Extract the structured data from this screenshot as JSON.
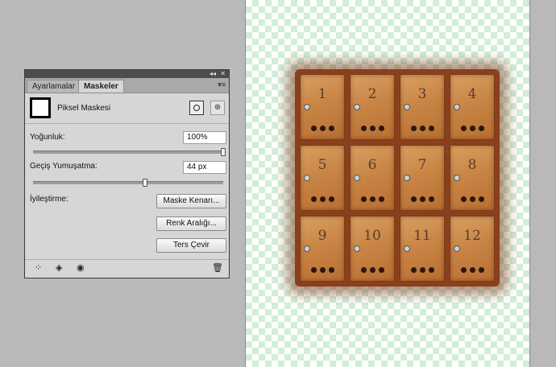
{
  "panel": {
    "tabs": [
      {
        "label": "Ayarlamalar"
      },
      {
        "label": "Maskeler"
      }
    ],
    "mask_type_label": "Piksel Maskesi",
    "density": {
      "label": "Yoğunluk:",
      "value": "100%",
      "percent": 100
    },
    "feather": {
      "label": "Geçiş Yumuşatma:",
      "value": "44 px",
      "percent": 59
    },
    "refine": {
      "label": "İyileştirme:",
      "buttons": [
        "Maske Kenarı...",
        "Renk Aralığı...",
        "Ters Çevir"
      ]
    },
    "footer_icons": [
      "load-selection-icon",
      "apply-mask-icon",
      "eye-icon",
      "trash-icon"
    ]
  },
  "image": {
    "box_numbers": [
      "1",
      "2",
      "3",
      "4",
      "5",
      "6",
      "7",
      "8",
      "9",
      "10",
      "11",
      "12"
    ]
  }
}
